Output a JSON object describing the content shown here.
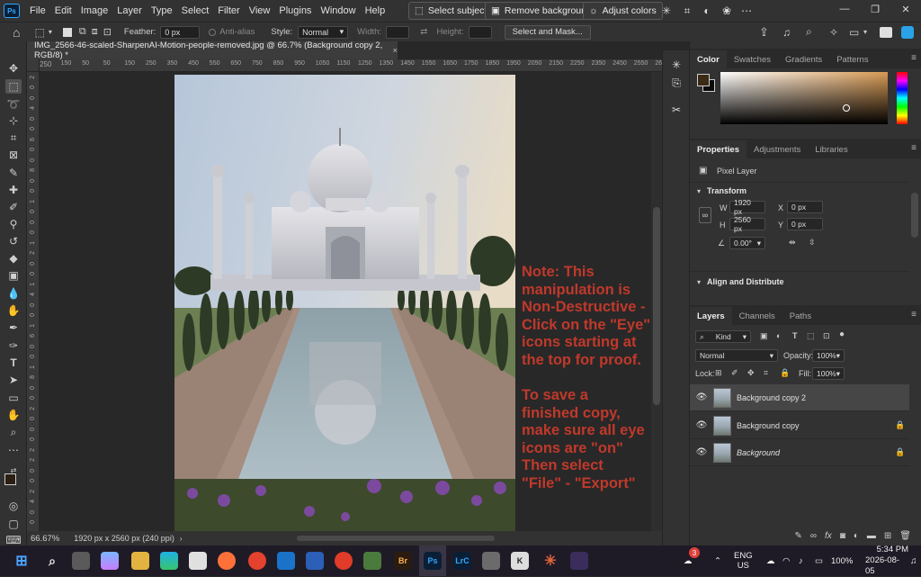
{
  "menu": {
    "logo": "Ps",
    "items": [
      "File",
      "Edit",
      "Image",
      "Layer",
      "Type",
      "Select",
      "Filter",
      "View",
      "Plugins",
      "Window",
      "Help"
    ]
  },
  "topbar": {
    "select_subject": "Select subject",
    "remove_background": "Remove background",
    "adjust_colors": "Adjust colors"
  },
  "options": {
    "feather_label": "Feather:",
    "feather_value": "0 px",
    "antialias_label": "Anti-alias",
    "style_label": "Style:",
    "style_value": "Normal",
    "width_label": "Width:",
    "height_label": "Height:",
    "select_mask_label": "Select and Mask..."
  },
  "document": {
    "tab_title": "IMG_2566-46-scaled-SharpenAI-Motion-people-removed.jpg @ 66.7% (Background copy 2, RGB/8) *",
    "close": "×"
  },
  "rulers": {
    "top": [
      "250",
      "200",
      "150",
      "100",
      "50",
      "0",
      "50",
      "100",
      "150",
      "200",
      "250",
      "300",
      "350",
      "400",
      "450",
      "500",
      "550",
      "600",
      "650",
      "700",
      "750",
      "800",
      "850",
      "900",
      "950",
      "1000",
      "1050",
      "1100",
      "1150",
      "1200",
      "1250",
      "1300",
      "1350",
      "1400",
      "1450",
      "1500",
      "1550",
      "1600",
      "1650",
      "1700",
      "1750",
      "1800",
      "1850",
      "1900",
      "1950",
      "2000",
      "2050",
      "2100",
      "2150",
      "2200",
      "2250",
      "2300",
      "2350",
      "2400",
      "2450",
      "2500",
      "2550",
      "2600",
      "2650"
    ],
    "left": [
      "0",
      "2",
      "0",
      "0",
      "4",
      "0",
      "0",
      "6",
      "0",
      "0",
      "8",
      "0",
      "0",
      "1",
      "0",
      "0",
      "0",
      "1",
      "2",
      "0",
      "0",
      "1",
      "4",
      "0",
      "0",
      "1",
      "6",
      "0",
      "0",
      "1",
      "8",
      "0",
      "0",
      "2",
      "0",
      "0",
      "0",
      "2",
      "2",
      "0",
      "0",
      "2",
      "4",
      "0",
      "0"
    ]
  },
  "note": {
    "paragraph1": "Note: This\nmanipulation is\nNon-Destructive -\nClick on the \"Eye\"\nicons starting at\nthe top for proof.",
    "paragraph2": "To save a\nfinished copy,\nmake sure all eye\nicons are \"on\"\nThen select\n\"File\" - \"Export\"",
    "color": "#c0392b"
  },
  "status": {
    "zoom": "66.67%",
    "info": "1920 px x 2560 px (240 ppi)"
  },
  "panels": {
    "color": {
      "tabs": [
        "Color",
        "Swatches",
        "Gradients",
        "Patterns"
      ],
      "hue": "#d89a55"
    },
    "properties": {
      "tabs": [
        "Properties",
        "Adjustments",
        "Libraries"
      ],
      "layer_type": "Pixel Layer",
      "transform_label": "Transform",
      "w_label": "W",
      "w_value": "1920 px",
      "h_label": "H",
      "h_value": "2560 px",
      "x_label": "X",
      "x_value": "0 px",
      "y_label": "Y",
      "y_value": "0 px",
      "angle_value": "0.00°",
      "align_label": "Align and Distribute"
    },
    "layers": {
      "tabs": [
        "Layers",
        "Channels",
        "Paths"
      ],
      "kind_value": "Kind",
      "blend_mode": "Normal",
      "opacity_label": "Opacity:",
      "opacity_value": "100%",
      "lock_label": "Lock:",
      "fill_label": "Fill:",
      "fill_value": "100%",
      "items": [
        {
          "name": "Background copy 2",
          "locked": false,
          "selected": true
        },
        {
          "name": "Background copy",
          "locked": true,
          "selected": false
        },
        {
          "name": "Background",
          "locked": true,
          "selected": false
        }
      ]
    }
  },
  "taskbar": {
    "lang": "ENG",
    "region": "US",
    "battery": "100%",
    "time": "5:34 PM",
    "date": "2026-08-05",
    "notification_count": "3",
    "apps": [
      "Br",
      "Ps",
      "LrC"
    ]
  }
}
